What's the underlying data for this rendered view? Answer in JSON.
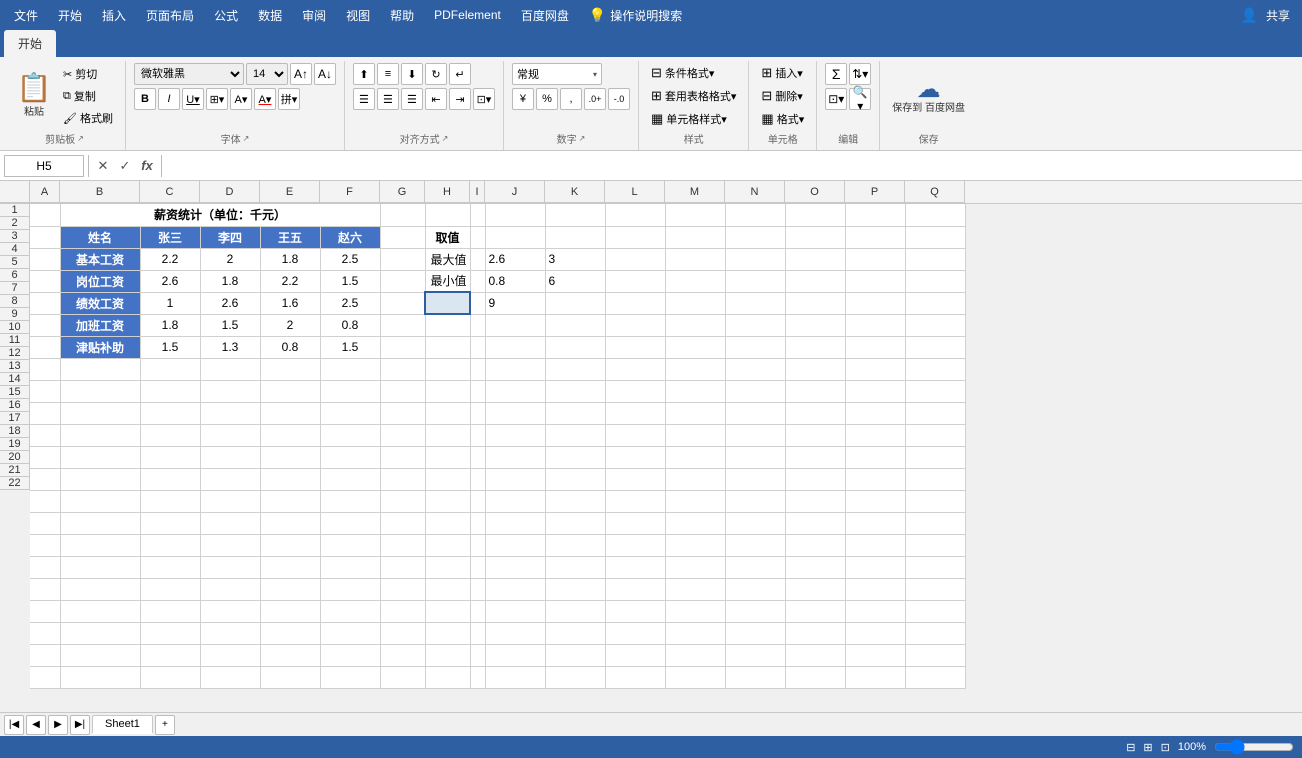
{
  "menubar": {
    "items": [
      "文件",
      "开始",
      "插入",
      "页面布局",
      "公式",
      "数据",
      "审阅",
      "视图",
      "帮助",
      "PDFelement",
      "百度网盘",
      "操作说明搜索"
    ]
  },
  "ribbon": {
    "tabs": [
      "开始",
      "插入",
      "页面布局",
      "公式",
      "数据",
      "审阅",
      "视图",
      "帮助",
      "PDFelement",
      "百度网盘"
    ],
    "active_tab": "开始",
    "groups": {
      "clipboard": {
        "label": "剪贴板",
        "paste": "粘贴",
        "cut": "✂",
        "copy": "⧉",
        "format_painter": "✏"
      },
      "font": {
        "label": "字体",
        "font_name": "微软雅黑",
        "font_size": "14",
        "bold": "B",
        "italic": "I",
        "underline": "U",
        "border": "⊞",
        "fill_color": "A",
        "font_color": "A"
      },
      "alignment": {
        "label": "对齐方式",
        "align_top": "⬆",
        "align_mid": "≡",
        "align_bot": "⬇",
        "align_left": "☰",
        "align_center": "☰",
        "align_right": "☰",
        "merge": "⊡",
        "indent_dec": "⇤",
        "indent_inc": "⇥",
        "wrap": "↵"
      },
      "number": {
        "label": "数字",
        "format": "常规",
        "percent": "%",
        "comma": ",",
        "currency": "¥",
        "dec_inc": "+.0",
        "dec_dec": "-.0"
      },
      "styles": {
        "label": "样式",
        "conditional": "条件格式▾",
        "table_format": "套用表格格式▾",
        "cell_styles": "单元格样式▾"
      },
      "cells": {
        "label": "单元格",
        "insert": "插入▾",
        "delete": "删除▾",
        "format": "格式▾"
      },
      "editing": {
        "label": "编辑",
        "sum": "Σ",
        "sort": "⇅",
        "find": "🔍",
        "fill": "⊡"
      },
      "save": {
        "label": "保存",
        "save_to_cloud": "保存到\n百度网盘"
      }
    }
  },
  "formula_bar": {
    "cell_ref": "H5",
    "cancel_label": "✕",
    "confirm_label": "✓",
    "function_label": "fx",
    "formula": ""
  },
  "columns": [
    "A",
    "B",
    "C",
    "D",
    "E",
    "F",
    "G",
    "H",
    "I",
    "J",
    "K",
    "L",
    "M",
    "N",
    "O",
    "P",
    "Q"
  ],
  "rows": 22,
  "spreadsheet": {
    "title": "薪资统计（单位：千元）",
    "title_cell": "B1",
    "title_merge": "B1:F1",
    "headers": [
      "姓名",
      "张三",
      "李四",
      "王五",
      "赵六"
    ],
    "data": [
      {
        "label": "基本工资",
        "values": [
          2.2,
          2,
          1.8,
          2.5
        ]
      },
      {
        "label": "岗位工资",
        "values": [
          2.6,
          1.8,
          2.2,
          1.5
        ]
      },
      {
        "label": "绩效工资",
        "values": [
          1,
          2.6,
          1.6,
          2.5
        ]
      },
      {
        "label": "加班工资",
        "values": [
          1.8,
          1.5,
          2,
          0.8
        ]
      },
      {
        "label": "津贴补助",
        "values": [
          1.5,
          1.3,
          0.8,
          1.5
        ]
      }
    ],
    "stats": {
      "title": "取值",
      "max_label": "最大值",
      "max_h": 2.6,
      "max_j": 3,
      "min_label": "最小值",
      "min_h": 0.8,
      "min_j": 6,
      "extra_j": 9
    }
  },
  "sheet_tabs": [
    "Sheet1"
  ],
  "status": {
    "items": []
  },
  "share_btn": "共享"
}
